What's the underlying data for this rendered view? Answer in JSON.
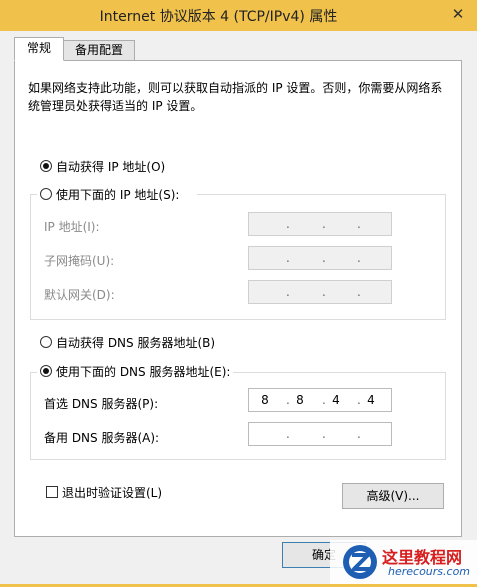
{
  "window": {
    "title": "Internet 协议版本 4 (TCP/IPv4) 属性",
    "close_glyph": "✕"
  },
  "tabs": [
    {
      "label": "常规"
    },
    {
      "label": "备用配置"
    }
  ],
  "description": "如果网络支持此功能，则可以获取自动指派的 IP 设置。否则，你需要从网络系统管理员处获得适当的 IP 设置。",
  "ip_section": {
    "auto_label": "自动获得 IP 地址(O)",
    "manual_label": "使用下面的 IP 地址(S):",
    "selected": "auto",
    "fields": [
      {
        "label": "IP 地址(I):",
        "value": [
          "",
          "",
          "",
          ""
        ]
      },
      {
        "label": "子网掩码(U):",
        "value": [
          "",
          "",
          "",
          ""
        ]
      },
      {
        "label": "默认网关(D):",
        "value": [
          "",
          "",
          "",
          ""
        ]
      }
    ]
  },
  "dns_section": {
    "auto_label": "自动获得 DNS 服务器地址(B)",
    "manual_label": "使用下面的 DNS 服务器地址(E):",
    "selected": "manual",
    "fields": [
      {
        "label": "首选 DNS 服务器(P):",
        "value": [
          "8",
          "8",
          "4",
          "4"
        ]
      },
      {
        "label": "备用 DNS 服务器(A):",
        "value": [
          "",
          "",
          "",
          ""
        ]
      }
    ]
  },
  "validate_checkbox": {
    "label": "退出时验证设置(L)",
    "checked": false
  },
  "advanced_button": {
    "label": "高级(V)..."
  },
  "ok_button": {
    "label": "确定"
  },
  "watermark": {
    "title": "这里教程网",
    "url": "herecours.com",
    "logo_letter": "Z"
  },
  "colors": {
    "titlebar": "#f0c24c",
    "watermark_red": "#d81e1e",
    "watermark_blue": "#1e5fb4"
  }
}
